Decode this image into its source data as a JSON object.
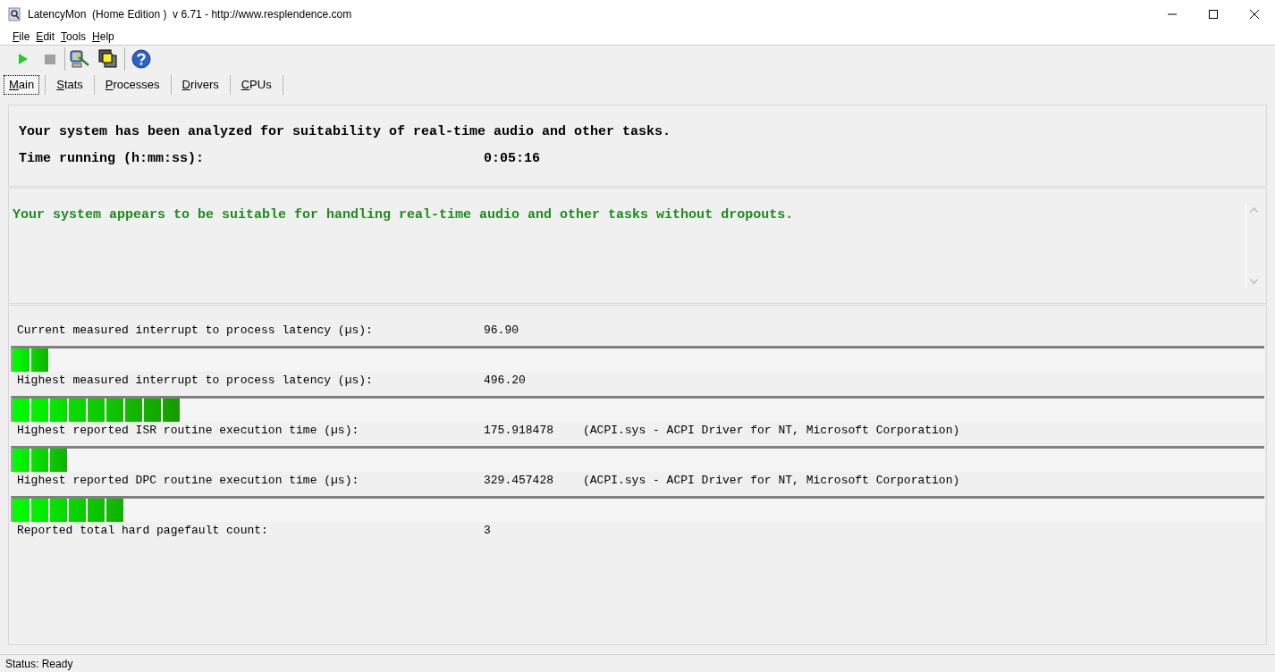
{
  "window": {
    "title": "LatencyMon  (Home Edition )  v 6.71 - http://www.resplendence.com"
  },
  "menu": [
    "File",
    "Edit",
    "Tools",
    "Help"
  ],
  "tabs": [
    {
      "label": "Main",
      "selected": true
    },
    {
      "label": "Stats",
      "selected": false
    },
    {
      "label": "Processes",
      "selected": false
    },
    {
      "label": "Drivers",
      "selected": false
    },
    {
      "label": "CPUs",
      "selected": false
    }
  ],
  "summary": {
    "headline": "Your system has been analyzed for suitability of real-time audio and other tasks.",
    "time_label": "Time running (h:mm:ss):",
    "time_value": "0:05:16"
  },
  "verdict": "Your system appears to be suitable for handling real-time audio and other tasks without dropouts.",
  "measurements": [
    {
      "kind": "bar",
      "label": "Current measured interrupt to process latency (µs):",
      "value": "96.90",
      "level": 0.03
    },
    {
      "kind": "bar",
      "label": "Highest measured interrupt to process latency (µs):",
      "value": "496.20",
      "level": 0.135
    },
    {
      "kind": "bar",
      "label": "Highest reported ISR routine execution time (µs):",
      "value": "175.918478",
      "detail": "(ACPI.sys - ACPI Driver for NT, Microsoft Corporation)",
      "level": 0.045
    },
    {
      "kind": "bar",
      "label": "Highest reported DPC routine execution time (µs):",
      "value": "329.457428",
      "detail": "(ACPI.sys - ACPI Driver for NT, Microsoft Corporation)",
      "level": 0.09
    },
    {
      "kind": "plain",
      "label": "Reported total hard pagefault count:",
      "value": "3"
    }
  ],
  "status_bar": "Status: Ready"
}
